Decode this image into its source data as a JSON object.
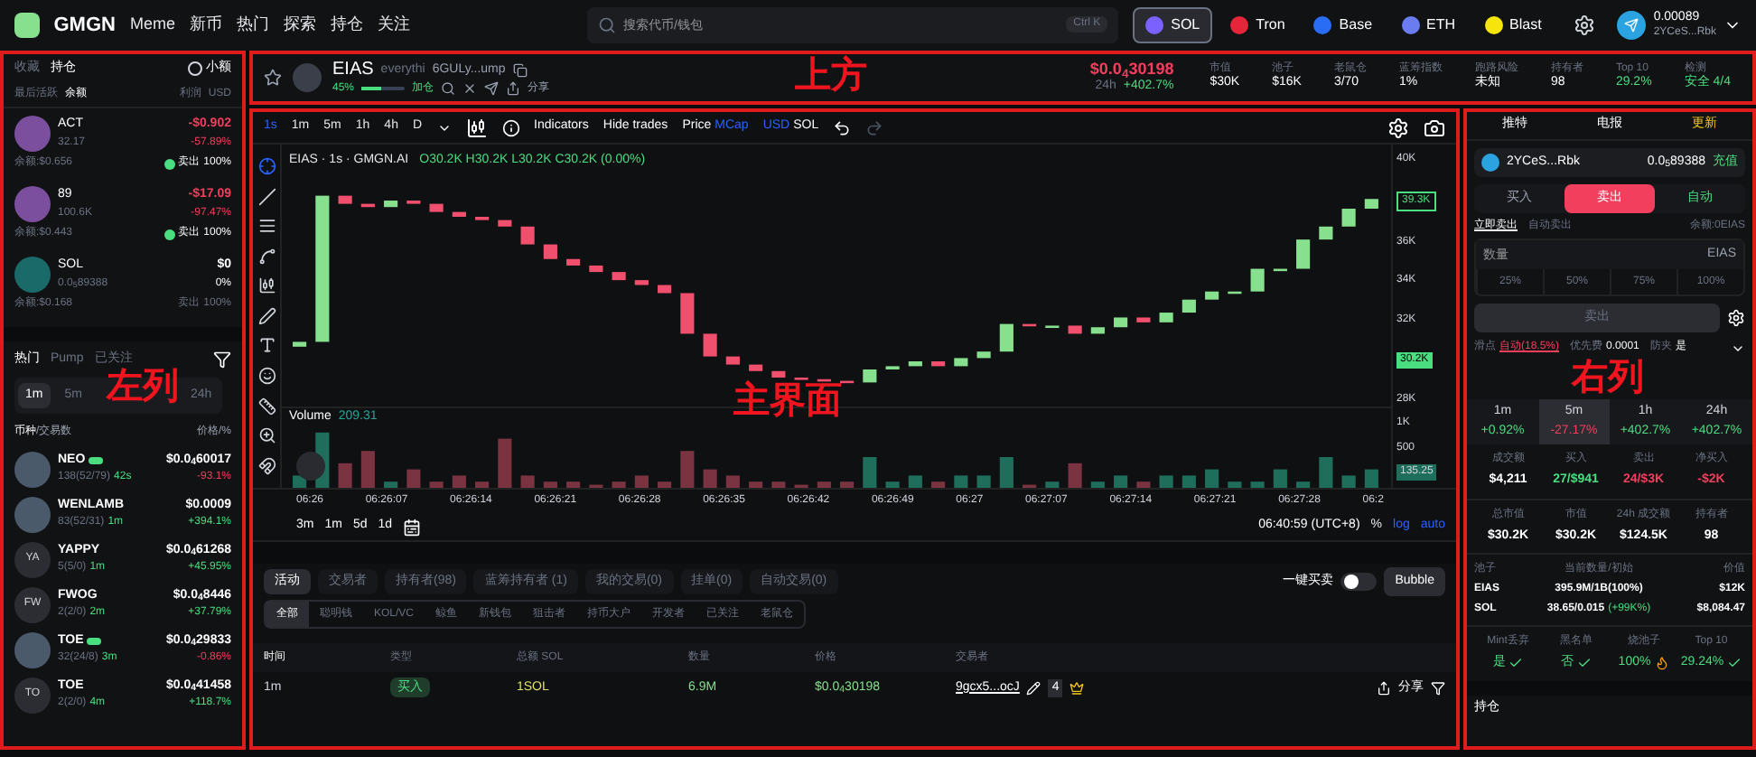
{
  "annotations": {
    "top": "上方",
    "left": "左列",
    "main": "主界面",
    "right": "右列"
  },
  "nav": {
    "logo": "GMGN",
    "links": [
      "Meme",
      "新币",
      "热门",
      "探索",
      "持仓",
      "关注"
    ],
    "search": {
      "placeholder": "搜索代币/钱包",
      "shortcut": "Ctrl K"
    },
    "chains": [
      {
        "label": "SOL",
        "selected": true,
        "color": "#7b61ff"
      },
      {
        "label": "Tron",
        "selected": false,
        "color": "#e5253a"
      },
      {
        "label": "Base",
        "selected": false,
        "color": "#2a6df5"
      },
      {
        "label": "ETH",
        "selected": false,
        "color": "#6b7cf0"
      },
      {
        "label": "Blast",
        "selected": false,
        "color": "#f5e50b"
      }
    ],
    "wallet": {
      "balance": "0.00089",
      "address": "2YCeS...Rbk"
    }
  },
  "token_bar": {
    "symbol": "EIAS",
    "name": "everythi",
    "address": "6GULy...ump",
    "progress": "45%",
    "level": 0.45,
    "tag": "加仓",
    "share": "分享",
    "price": "$0.0$_{4}$30198",
    "change_label": "24h",
    "change": "+402.7%",
    "stats": [
      {
        "label": "市值",
        "value": "$30K"
      },
      {
        "label": "池子",
        "value": "$16K"
      },
      {
        "label": "老鼠仓",
        "value": "3/70"
      },
      {
        "label": "蓝筹指数",
        "value": "1%"
      },
      {
        "label": "跑路风险",
        "value": "未知"
      },
      {
        "label": "持有者",
        "value": "98"
      },
      {
        "label": "Top 10",
        "value": "29.2%"
      },
      {
        "label": "检测",
        "value": "安全 4/4"
      }
    ]
  },
  "left": {
    "tabs": [
      {
        "label": "收藏",
        "selected": false
      },
      {
        "label": "持仓",
        "selected": true
      }
    ],
    "small_filter": {
      "label": "小额",
      "checked": false
    },
    "sort": [
      "最后活跃",
      "余额",
      "利润",
      "USD"
    ],
    "holdings": [
      {
        "symbol": "ACT",
        "amount": "32.17",
        "pnl": "-$0.902",
        "pnl_pct": "-57.89%",
        "balance": "余额:$0.656",
        "action": "卖出",
        "share": "100%",
        "color": "#f23f5d",
        "disabled": false
      },
      {
        "symbol": "89",
        "amount": "100.6K",
        "pnl": "-$17.09",
        "pnl_pct": "-97.47%",
        "balance": "余额:$0.443",
        "action": "卖出",
        "share": "100%",
        "color": "#f23f5d",
        "disabled": false
      },
      {
        "symbol": "SOL",
        "amount": "0.0$_{5}$89388",
        "pnl": "$0",
        "pnl_pct": "0%",
        "balance": "余额:$0.168",
        "action": "卖出",
        "share": "100%",
        "color": "#ffffff",
        "disabled": true
      }
    ],
    "hot_tabs": [
      {
        "label": "热门",
        "selected": true
      },
      {
        "label": "Pump",
        "selected": false
      },
      {
        "label": "已关注",
        "selected": false
      }
    ],
    "timeframes": [
      {
        "label": "1m",
        "selected": true
      },
      {
        "label": "5m",
        "selected": false
      },
      {
        "label": "24h",
        "selected": false
      }
    ],
    "columns": [
      "币种",
      "/交易数",
      "价格",
      "/%"
    ],
    "tokens": [
      {
        "symbol": "NEO",
        "badge": true,
        "stats": "138(52/79)",
        "age": "42s",
        "price": "$0.0$_{4}$60017",
        "change": "-93.1%",
        "color": "#f23f5d"
      },
      {
        "symbol": "WENLAMB",
        "badge": false,
        "stats": "83(52/31)",
        "age": "1m",
        "price": "$0.0009",
        "change": "+394.1%",
        "color": "#4ade80"
      },
      {
        "symbol": "YAPPY",
        "badge": false,
        "stats": "5(5/0)",
        "age": "1m",
        "price": "$0.0$_{4}$61268",
        "change": "+45.95%",
        "color": "#4ade80",
        "initials": "YA"
      },
      {
        "symbol": "FWOG",
        "badge": false,
        "stats": "2(2/0)",
        "age": "2m",
        "price": "$0.0$_{4}$8446",
        "change": "+37.79%",
        "color": "#4ade80",
        "initials": "FW"
      },
      {
        "symbol": "TOE",
        "badge": true,
        "stats": "32(24/8)",
        "age": "3m",
        "price": "$0.0$_{4}$29833",
        "change": "-0.86%",
        "color": "#f23f5d"
      },
      {
        "symbol": "TOE",
        "badge": false,
        "stats": "2(2/0)",
        "age": "4m",
        "price": "$0.0$_{4}$41458",
        "change": "+118.7%",
        "color": "#4ade80",
        "initials": "TO"
      }
    ]
  },
  "chart": {
    "intervals": [
      {
        "label": "1s",
        "selected": true
      },
      {
        "label": "1m",
        "selected": false
      },
      {
        "label": "5m",
        "selected": false
      },
      {
        "label": "1h",
        "selected": false
      },
      {
        "label": "4h",
        "selected": false
      },
      {
        "label": "D",
        "selected": false
      }
    ],
    "indicators": "Indicators",
    "hide_trades": "Hide trades",
    "price_mode": [
      {
        "label": "Price",
        "selected": false
      },
      {
        "label": "MCap",
        "selected": true
      }
    ],
    "currency": [
      {
        "label": "USD",
        "selected": true
      },
      {
        "label": "SOL",
        "selected": false
      }
    ],
    "legend": "EIAS · 1s · GMGN.AI",
    "ohlc": "O30.2K H30.2K L30.2K C30.2K (0.00%)",
    "y_ticks": [
      "40K",
      "36K",
      "34K",
      "32K",
      "28K"
    ],
    "last_tag": "39.3K",
    "current_tag": "30.2K",
    "volume_label": "Volume",
    "volume_value": "209.31",
    "volume_ticks": [
      "1K",
      "500"
    ],
    "volume_tag": "135.25",
    "x_ticks": [
      "06:26",
      "06:26:07",
      "06:26:14",
      "06:26:21",
      "06:26:28",
      "06:26:35",
      "06:26:42",
      "06:26:49",
      "06:27",
      "06:27:07",
      "06:27:14",
      "06:27:21",
      "06:27:28",
      "06:2"
    ],
    "ranges": [
      "3m",
      "1m",
      "5d",
      "1d"
    ],
    "clock": "06:40:59 (UTC+8)",
    "scale_options": [
      {
        "label": "%",
        "selected": false
      },
      {
        "label": "log",
        "selected": true
      },
      {
        "label": "auto",
        "selected": true
      }
    ]
  },
  "activity": {
    "tabs": [
      {
        "label": "活动",
        "selected": true
      },
      {
        "label": "交易者",
        "selected": false
      },
      {
        "label": "持有者(98)",
        "selected": false
      },
      {
        "label": "蓝筹持有者 (1)",
        "selected": false
      },
      {
        "label": "我的交易(0)",
        "selected": false
      },
      {
        "label": "挂单(0)",
        "selected": false
      },
      {
        "label": "自动交易(0)",
        "selected": false
      }
    ],
    "quick_trade": {
      "label": "一键买卖",
      "on": false
    },
    "bubble": "Bubble",
    "filters": [
      {
        "label": "全部",
        "selected": true
      },
      {
        "label": "聪明钱",
        "selected": false
      },
      {
        "label": "KOL/VC",
        "selected": false
      },
      {
        "label": "鲸鱼",
        "selected": false
      },
      {
        "label": "新钱包",
        "selected": false
      },
      {
        "label": "狙击者",
        "selected": false
      },
      {
        "label": "持币大户",
        "selected": false
      },
      {
        "label": "开发者",
        "selected": false
      },
      {
        "label": "已关注",
        "selected": false
      },
      {
        "label": "老鼠仓",
        "selected": false
      }
    ],
    "columns": [
      "时间",
      "类型",
      "总额 SOL",
      "数量",
      "价格",
      "交易者"
    ],
    "rows": [
      {
        "time": "1m",
        "type": "买入",
        "total": "1SOL",
        "amount": "6.9M",
        "price": "$0.0$_{4}$30198",
        "trader": "9gcx5...ocJ",
        "count": "4",
        "share": "分享"
      }
    ]
  },
  "right": {
    "links": [
      "推特",
      "电报",
      "更新"
    ],
    "wallet": {
      "address": "2YCeS...Rbk",
      "balance": "0.0$_{5}$89388",
      "deposit": "充值"
    },
    "sides": [
      {
        "label": "买入",
        "selected": false
      },
      {
        "label": "卖出",
        "selected": true
      },
      {
        "label": "自动",
        "selected": false
      }
    ],
    "modes": [
      {
        "label": "立即卖出",
        "selected": true
      },
      {
        "label": "自动卖出",
        "selected": false
      }
    ],
    "balance": "余额:0EIAS",
    "amount": {
      "placeholder": "数量",
      "unit": "EIAS"
    },
    "percents": [
      "25%",
      "50%",
      "75%",
      "100%"
    ],
    "submit": {
      "label": "卖出",
      "disabled": true
    },
    "settings": [
      {
        "label": "滑点",
        "value": "自动(18.5%)"
      },
      {
        "label": "优先费",
        "value": "0.0001"
      },
      {
        "label": "防夹",
        "value": "是"
      }
    ],
    "periods": [
      {
        "label": "1m",
        "change": "+0.92%",
        "color": "#4ade80",
        "selected": false
      },
      {
        "label": "5m",
        "change": "-27.17%",
        "color": "#f23f5d",
        "selected": true
      },
      {
        "label": "1h",
        "change": "+402.7%",
        "color": "#4ade80",
        "selected": false
      },
      {
        "label": "24h",
        "change": "+402.7%",
        "color": "#4ade80",
        "selected": false
      }
    ],
    "trade_stats": [
      {
        "label": "成交额",
        "value": "$4,211",
        "color": "#ffffff"
      },
      {
        "label": "买入",
        "value": "27/$941",
        "color": "#4ade80"
      },
      {
        "label": "卖出",
        "value": "24/$3K",
        "color": "#f23f5d"
      },
      {
        "label": "净买入",
        "value": "-$2K",
        "color": "#f23f5d"
      }
    ],
    "market_stats": [
      {
        "label": "总市值",
        "value": "$30.2K"
      },
      {
        "label": "市值",
        "value": "$30.2K"
      },
      {
        "label": "24h 成交额",
        "value": "$124.5K"
      },
      {
        "label": "持有者",
        "value": "98"
      }
    ],
    "pool": {
      "columns": [
        "池子",
        "当前数量/初始",
        "价值"
      ],
      "rows": [
        {
          "asset": "EIAS",
          "amount": "395.9M/1B(100%)",
          "value": "$12K"
        },
        {
          "asset": "SOL",
          "amount": "38.65/0.015",
          "growth": "(+99K%)",
          "value": "$8,084.47"
        }
      ]
    },
    "checks": [
      {
        "label": "Mint丢弃",
        "value": "是",
        "kind": "check"
      },
      {
        "label": "黑名单",
        "value": "否",
        "kind": "check"
      },
      {
        "label": "烧池子",
        "value": "100%",
        "kind": "fire"
      },
      {
        "label": "Top 10",
        "value": "29.24%",
        "kind": "check"
      }
    ],
    "footer": "持仓"
  }
}
